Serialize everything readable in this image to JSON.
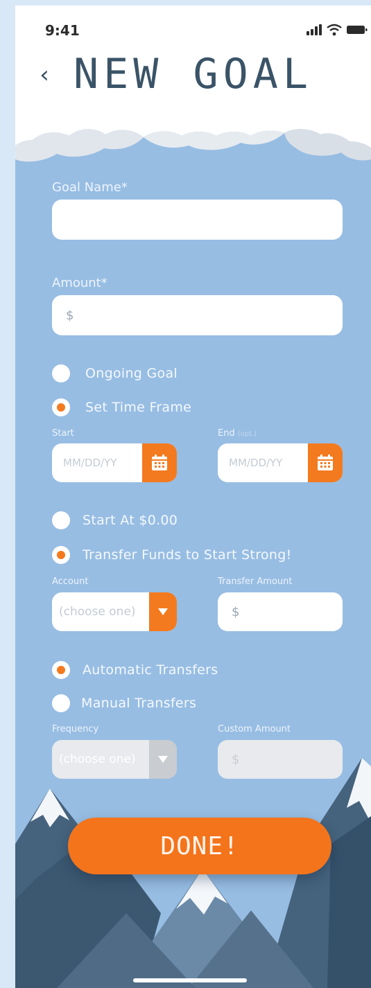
{
  "status": {
    "time": "9:41"
  },
  "header": {
    "title": "NEW GOAL"
  },
  "form": {
    "goal_name_label": "Goal Name*",
    "goal_name_value": "",
    "amount_label": "Amount*",
    "amount_prefix": "$",
    "ongoing_goal": "Ongoing Goal",
    "set_time_frame": "Set Time Frame",
    "start_label": "Start",
    "end_label": "End",
    "end_opt": "(opt.)",
    "start_placeholder": "MM/DD/YY",
    "end_placeholder": "MM/DD/YY",
    "start_at_zero": "Start At $0.00",
    "transfer_funds": "Transfer Funds to Start Strong!",
    "account_label": "Account",
    "account_value": "(choose one)",
    "transfer_amount_label": "Transfer Amount",
    "transfer_amount_prefix": "$",
    "automatic_transfers": "Automatic Transfers",
    "manual_transfers": "Manual Transfers",
    "frequency_label": "Frequency",
    "frequency_value": "(choose one)",
    "custom_amount_label": "Custom Amount",
    "custom_amount_prefix": "$",
    "selected": {
      "timeframe": "set_time_frame",
      "start_funds": "transfer_funds",
      "transfers": "automatic_transfers"
    }
  },
  "actions": {
    "done_label": "DONE!"
  },
  "colors": {
    "accent": "#f47a1f",
    "background": "#97bde3",
    "title": "#3a5367"
  }
}
